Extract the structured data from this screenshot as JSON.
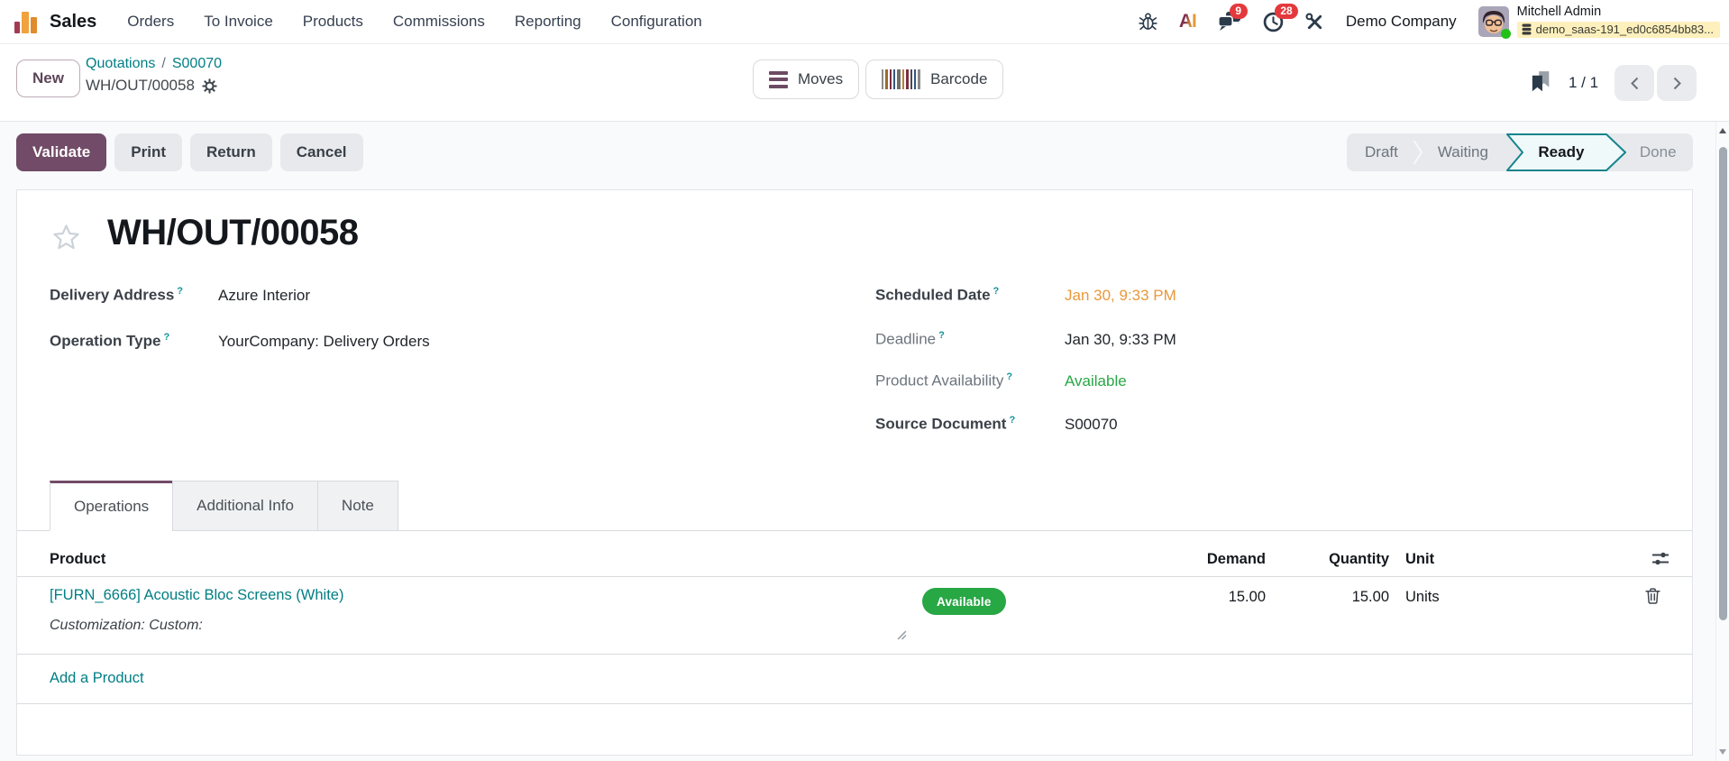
{
  "navbar": {
    "app_name": "Sales",
    "menu": [
      "Orders",
      "To Invoice",
      "Products",
      "Commissions",
      "Reporting",
      "Configuration"
    ],
    "messages_badge": "9",
    "activities_badge": "28",
    "company_name": "Demo Company",
    "user_name": "Mitchell Admin",
    "database": "demo_saas-191_ed0c6854bb83..."
  },
  "control_panel": {
    "new_button": "New",
    "breadcrumb_parent": "Quotations",
    "breadcrumb_separator": "/",
    "breadcrumb_sale": "S00070",
    "breadcrumb_current": "WH/OUT/00058",
    "moves_button": "Moves",
    "barcode_button": "Barcode",
    "pager_value": "1 / 1"
  },
  "buttons": {
    "validate": "Validate",
    "print": "Print",
    "return": "Return",
    "cancel": "Cancel"
  },
  "statusbar": {
    "steps": [
      "Draft",
      "Waiting",
      "Ready",
      "Done"
    ],
    "active_step": "Ready"
  },
  "form": {
    "title": "WH/OUT/00058",
    "help_marker": "?",
    "delivery_address_label": "Delivery Address",
    "delivery_address_value": "Azure Interior",
    "operation_type_label": "Operation Type",
    "operation_type_value": "YourCompany: Delivery Orders",
    "scheduled_date_label": "Scheduled Date",
    "scheduled_date_value": "Jan 30, 9:33 PM",
    "deadline_label": "Deadline",
    "deadline_value": "Jan 30, 9:33 PM",
    "product_availability_label": "Product Availability",
    "product_availability_value": "Available",
    "source_document_label": "Source Document",
    "source_document_value": "S00070"
  },
  "tabs": [
    "Operations",
    "Additional Info",
    "Note"
  ],
  "operations_table": {
    "product_header": "Product",
    "demand_header": "Demand",
    "quantity_header": "Quantity",
    "unit_header": "Unit",
    "rows": [
      {
        "product": "[FURN_6666] Acoustic Bloc Screens (White)",
        "description": "Customization: Custom:",
        "availability_badge": "Available",
        "demand": "15.00",
        "quantity": "15.00",
        "unit": "Units"
      }
    ],
    "add_line_label": "Add a Product"
  },
  "colors": {
    "primary": "#714B67",
    "link": "#017E84",
    "success": "#28A745",
    "warning_text": "#E8983A",
    "badge_red": "#E4393C",
    "ready_fill": "#F0F9FA",
    "ready_border": "#15848C"
  }
}
